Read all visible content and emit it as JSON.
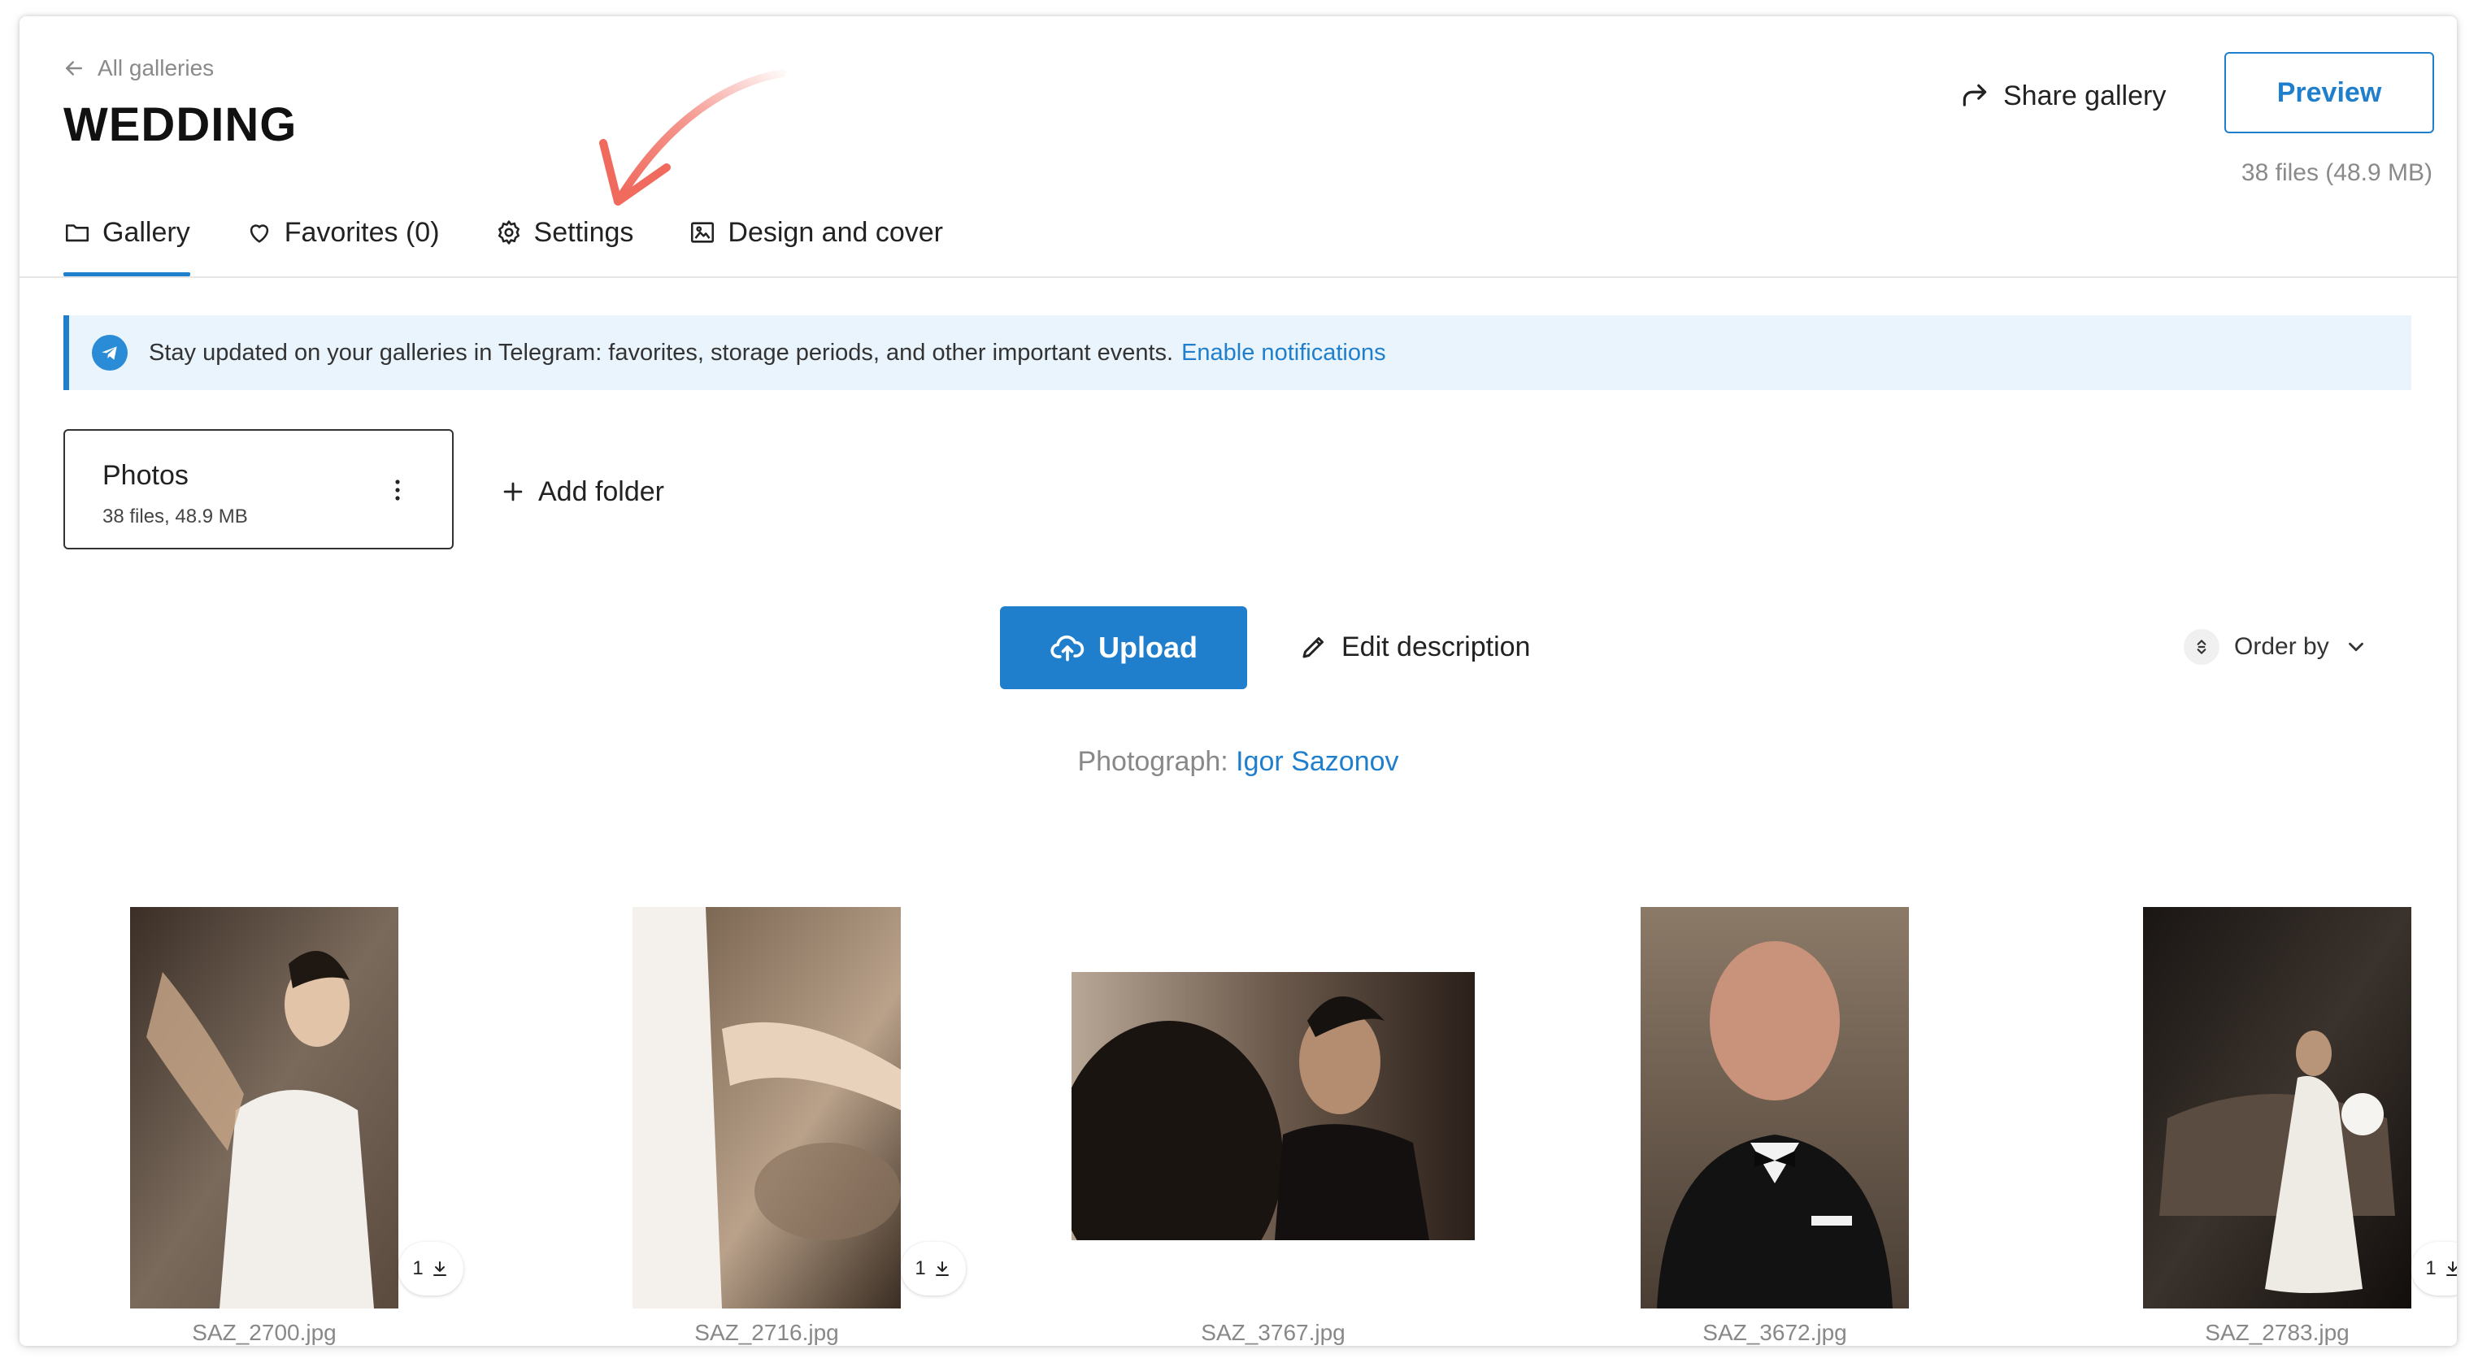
{
  "header": {
    "back_label": "All galleries",
    "title": "WEDDING",
    "share_label": "Share gallery",
    "preview_label": "Preview",
    "files_summary": "38 files (48.9 MB)"
  },
  "tabs": [
    {
      "label": "Gallery",
      "icon": "folder-icon",
      "active": true
    },
    {
      "label": "Favorites (0)",
      "icon": "heart-icon",
      "active": false
    },
    {
      "label": "Settings",
      "icon": "gear-icon",
      "active": false
    },
    {
      "label": "Design and cover",
      "icon": "image-icon",
      "active": false
    }
  ],
  "banner": {
    "icon": "telegram-icon",
    "text": "Stay updated on your galleries in Telegram: favorites, storage periods, and other important events.",
    "link": "Enable notifications"
  },
  "folder": {
    "name": "Photos",
    "meta": "38 files, 48.9 MB"
  },
  "add_folder_label": "Add folder",
  "toolbar": {
    "upload_label": "Upload",
    "edit_description_label": "Edit description",
    "order_by_label": "Order by"
  },
  "photographer": {
    "prefix": "Photograph:",
    "name": "Igor Sazonov"
  },
  "photos": [
    {
      "filename": "SAZ_2700.jpg",
      "downloads": "1",
      "orientation": "portrait"
    },
    {
      "filename": "SAZ_2716.jpg",
      "downloads": "1",
      "orientation": "portrait"
    },
    {
      "filename": "SAZ_3767.jpg",
      "downloads": "",
      "orientation": "landscape"
    },
    {
      "filename": "SAZ_3672.jpg",
      "downloads": "",
      "orientation": "portrait"
    },
    {
      "filename": "SAZ_2783.jpg",
      "downloads": "1",
      "orientation": "portrait"
    }
  ],
  "colors": {
    "accent": "#1f7fcc",
    "banner_bg": "#eaf4fc",
    "annotation_arrow": "#f06a5e"
  }
}
